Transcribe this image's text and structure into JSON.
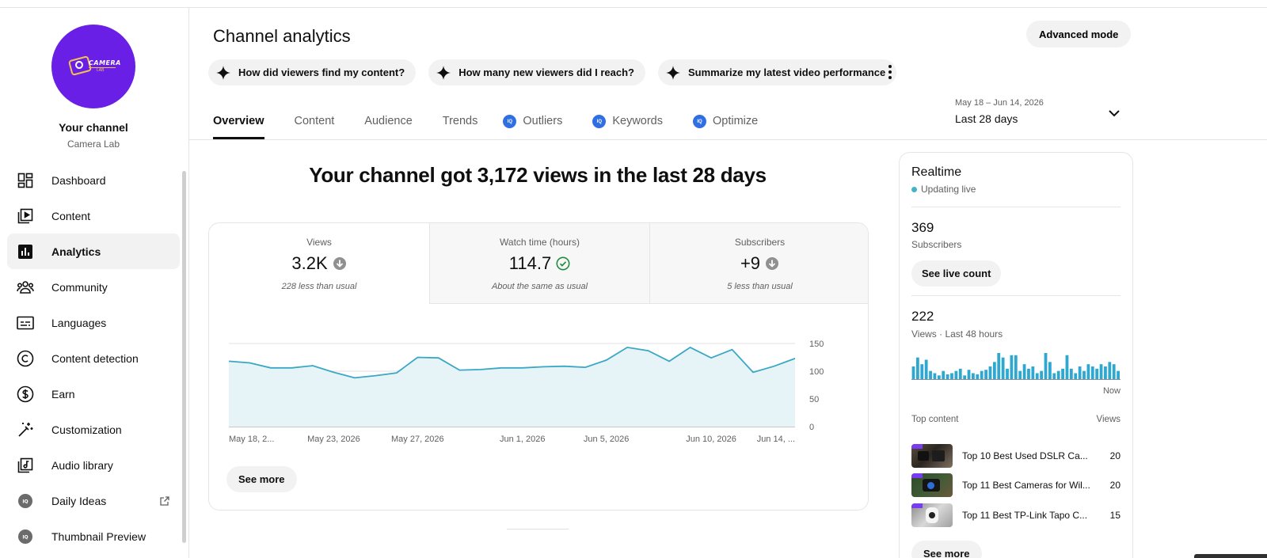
{
  "sidebar": {
    "channel_title": "Your channel",
    "channel_name": "Camera Lab",
    "logo_text": "CAMERA",
    "logo_sub": "LAB",
    "items": [
      {
        "label": "Dashboard",
        "icon": "dashboard-icon"
      },
      {
        "label": "Content",
        "icon": "content-icon"
      },
      {
        "label": "Analytics",
        "icon": "analytics-icon",
        "active": true
      },
      {
        "label": "Community",
        "icon": "community-icon"
      },
      {
        "label": "Languages",
        "icon": "languages-icon"
      },
      {
        "label": "Content detection",
        "icon": "copyright-icon"
      },
      {
        "label": "Earn",
        "icon": "dollar-icon"
      },
      {
        "label": "Customization",
        "icon": "magic-wand-icon"
      },
      {
        "label": "Audio library",
        "icon": "audio-library-icon"
      },
      {
        "label": "Daily Ideas",
        "icon": "vidiq-icon"
      },
      {
        "label": "Thumbnail Preview",
        "icon": "vidiq-icon"
      }
    ]
  },
  "header": {
    "title": "Channel analytics",
    "advanced_mode": "Advanced mode",
    "chips": [
      "How did viewers find my content?",
      "How many new viewers did I reach?",
      "Summarize my latest video performance"
    ],
    "tabs": [
      {
        "label": "Overview",
        "active": true
      },
      {
        "label": "Content"
      },
      {
        "label": "Audience"
      },
      {
        "label": "Trends"
      },
      {
        "label": "Outliers",
        "badge": true
      },
      {
        "label": "Keywords",
        "badge": true
      },
      {
        "label": "Optimize",
        "badge": true
      }
    ],
    "date_range": "May 18 – Jun 14, 2026",
    "date_preset": "Last 28 days"
  },
  "main": {
    "headline": "Your channel got 3,172 views in the last 28 days",
    "metrics": [
      {
        "label": "Views",
        "value": "3.2K",
        "note": "228 less than usual",
        "status": "down"
      },
      {
        "label": "Watch time (hours)",
        "value": "114.7",
        "note": "About the same as usual",
        "status": "ok"
      },
      {
        "label": "Subscribers",
        "value": "+9",
        "note": "5 less than usual",
        "status": "down"
      }
    ],
    "see_more": "See more"
  },
  "chart_data": {
    "type": "area",
    "series": [
      {
        "values": [
          118,
          115,
          106,
          106,
          110,
          98,
          88,
          92,
          97,
          125,
          124,
          102,
          103,
          106,
          106,
          108,
          109,
          107,
          120,
          143,
          137,
          118,
          143,
          124,
          139,
          98,
          109,
          123
        ]
      }
    ],
    "x_tick_labels": [
      "May 18, 2...",
      "May 23, 2026",
      "May 27, 2026",
      "Jun 1, 2026",
      "Jun 5, 2026",
      "Jun 10, 2026",
      "Jun 14, ..."
    ],
    "ylim": [
      0,
      150
    ],
    "y_ticks": [
      0,
      50,
      100,
      150
    ],
    "grid": true,
    "color": "#3aa7c4",
    "fill": "#e6f4f8"
  },
  "realtime": {
    "title": "Realtime",
    "status": "Updating live",
    "subscribers": "369",
    "subscribers_label": "Subscribers",
    "live_count_button": "See live count",
    "views": "222",
    "views_label": "Views · Last 48 hours",
    "bars": [
      12,
      20,
      14,
      18,
      8,
      6,
      4,
      8,
      5,
      6,
      8,
      10,
      4,
      9,
      6,
      5,
      8,
      9,
      12,
      16,
      24,
      20,
      10,
      22,
      22,
      8,
      14,
      10,
      12,
      6,
      8,
      24,
      16,
      6,
      8,
      10,
      22,
      10,
      6,
      12,
      8,
      14,
      12,
      10,
      14,
      12,
      16,
      14,
      8
    ],
    "now_label": "Now",
    "top_content_label": "Top content",
    "views_col_label": "Views",
    "top_content": [
      {
        "title": "Top 10 Best Used DSLR Ca...",
        "views": "20"
      },
      {
        "title": "Top 11 Best Cameras for Wil...",
        "views": "20"
      },
      {
        "title": "Top 11 Best TP-Link Tapo C...",
        "views": "15"
      }
    ],
    "see_more": "See more"
  }
}
